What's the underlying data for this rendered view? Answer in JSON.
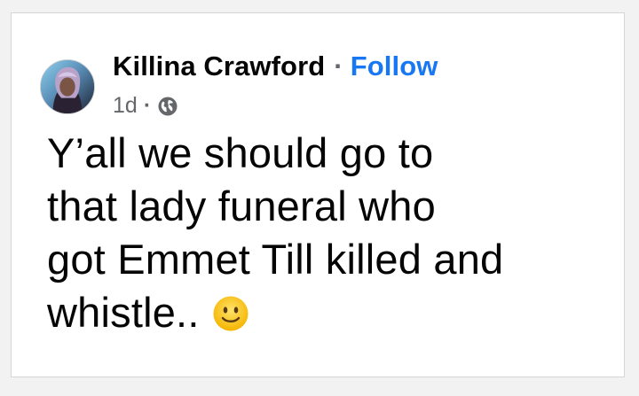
{
  "post": {
    "author_name": "Killina Crawford",
    "separator": "·",
    "follow_label": "Follow",
    "timestamp": "1d",
    "meta_separator": "·",
    "audience_icon": "globe-icon",
    "text_lines": [
      "Y’all we should go to",
      "that lady funeral who",
      "got Emmet Till killed and",
      "whistle.."
    ],
    "emoji": "slightly-smiling-face-icon"
  },
  "colors": {
    "author": "#050505",
    "follow": "#1877f2",
    "meta": "#65676b",
    "card_background": "#ffffff",
    "page_background": "#f2f2f2"
  }
}
